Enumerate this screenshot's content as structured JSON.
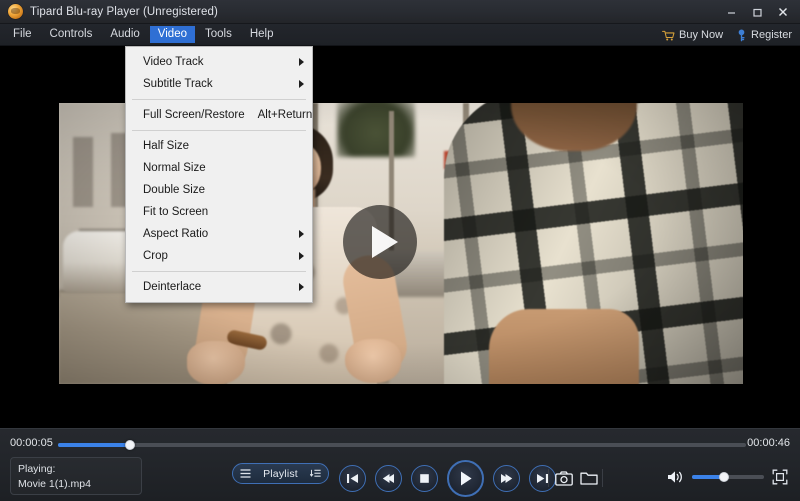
{
  "window": {
    "title": "Tipard Blu-ray Player (Unregistered)",
    "app_icon": "app-logo-icon",
    "controls": {
      "minimize": "minimize-icon",
      "maximize": "maximize-icon",
      "close": "close-icon"
    }
  },
  "menubar": {
    "items": [
      {
        "label": "File",
        "active": false
      },
      {
        "label": "Controls",
        "active": false
      },
      {
        "label": "Audio",
        "active": false
      },
      {
        "label": "Video",
        "active": true
      },
      {
        "label": "Tools",
        "active": false
      },
      {
        "label": "Help",
        "active": false
      }
    ],
    "right": {
      "buy_now": {
        "label": "Buy Now",
        "icon": "shopping-cart-icon",
        "color": "#d8a23a"
      },
      "register": {
        "label": "Register",
        "icon": "register-key-icon",
        "color": "#3d7fd6"
      }
    }
  },
  "video_menu": {
    "items": [
      {
        "label": "Video Track",
        "shortcut": "",
        "submenu": true,
        "separator_after": false
      },
      {
        "label": "Subtitle Track",
        "shortcut": "",
        "submenu": true,
        "separator_after": true
      },
      {
        "label": "Full Screen/Restore",
        "shortcut": "Alt+Return",
        "submenu": false,
        "separator_after": true
      },
      {
        "label": "Half Size",
        "shortcut": "",
        "submenu": false,
        "separator_after": false
      },
      {
        "label": "Normal Size",
        "shortcut": "",
        "submenu": false,
        "separator_after": false
      },
      {
        "label": "Double Size",
        "shortcut": "",
        "submenu": false,
        "separator_after": false
      },
      {
        "label": "Fit to Screen",
        "shortcut": "",
        "submenu": false,
        "separator_after": false
      },
      {
        "label": "Aspect Ratio",
        "shortcut": "",
        "submenu": true,
        "separator_after": false
      },
      {
        "label": "Crop",
        "shortcut": "",
        "submenu": true,
        "separator_after": true
      },
      {
        "label": "Deinterlace",
        "shortcut": "",
        "submenu": true,
        "separator_after": false
      }
    ]
  },
  "player": {
    "overlay_play_icon": "play-triangle-icon",
    "current_time": "00:00:05",
    "total_time": "00:00:46",
    "progress_percent": 10.5,
    "now_playing": {
      "status_label": "Playing:",
      "file_name": "Movie 1(1).mp4"
    },
    "playlist_button": {
      "label": "Playlist",
      "left_icon": "list-lines-icon",
      "right_icon": "playlist-sort-icon"
    },
    "transport": [
      {
        "name": "previous-button",
        "icon": "skip-previous-icon"
      },
      {
        "name": "rewind-button",
        "icon": "rewind-icon"
      },
      {
        "name": "stop-button",
        "icon": "stop-square-icon"
      },
      {
        "name": "play-button",
        "icon": "play-triangle-icon"
      },
      {
        "name": "fast-forward-button",
        "icon": "fast-forward-icon"
      },
      {
        "name": "next-button",
        "icon": "skip-next-icon"
      }
    ],
    "tools": [
      {
        "name": "snapshot-button",
        "icon": "camera-icon"
      },
      {
        "name": "open-folder-button",
        "icon": "folder-icon"
      }
    ],
    "volume": {
      "icon": "speaker-volume-icon",
      "level_percent": 45
    },
    "fullscreen_button": {
      "icon": "fullscreen-expand-icon"
    }
  },
  "theme": {
    "accent_blue": "#3b82e8",
    "menu_highlight": "#2f6fd4",
    "titlebar_bg": "#282b31",
    "bottombar_bg": "#23262b",
    "stage_bg": "#000000",
    "dropdown_bg": "#f0f0f0"
  }
}
